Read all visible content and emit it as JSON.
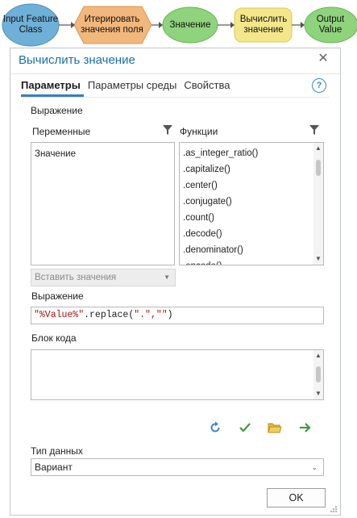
{
  "model": {
    "nodes": [
      {
        "label": "Input Feature Class"
      },
      {
        "label": "Итерировать значения поля"
      },
      {
        "label": "Значение"
      },
      {
        "label": "Вычислить значение"
      },
      {
        "label": "Output Value"
      }
    ],
    "colors": {
      "input": "#6fb0d8",
      "iterator": "#f2b77a",
      "variable": "#8fd37c",
      "tool": "#f4e78a",
      "output": "#8fd37c"
    }
  },
  "dialog": {
    "title": "Вычислить значение",
    "tabs": [
      "Параметры",
      "Параметры среды",
      "Свойства"
    ],
    "expression_section_label": "Выражение",
    "variables_label": "Переменные",
    "functions_label": "Функции",
    "variables": [
      "Значение"
    ],
    "functions": [
      ".as_integer_ratio()",
      ".capitalize()",
      ".center()",
      ".conjugate()",
      ".count()",
      ".decode()",
      ".denominator()",
      ".encode()"
    ],
    "insert_values_placeholder": "Вставить значения",
    "expression_label": "Выражение",
    "expression_value": {
      "string_part": "\"%Value%\"",
      "method_part": ".replace(",
      "args": "\".\",\"\"",
      "close": ")"
    },
    "code_block_label": "Блок кода",
    "code_block_value": "",
    "data_type_label": "Тип данных",
    "data_type_value": "Вариант",
    "ok_label": "OK",
    "accent_color": "#1a6fa8"
  }
}
